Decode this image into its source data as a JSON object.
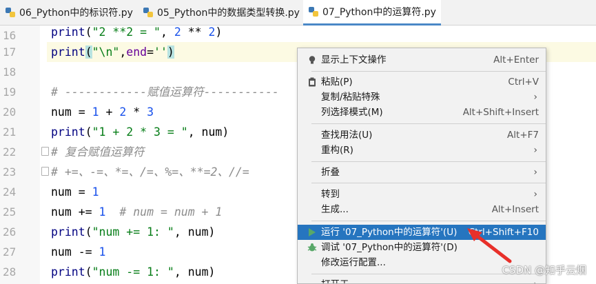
{
  "tabs": [
    {
      "label": "06_Python中的标识符.py"
    },
    {
      "label": "05_Python中的数据类型转换.py"
    },
    {
      "label": "07_Python中的运算符.py"
    }
  ],
  "line_numbers": [
    "16",
    "17",
    "18",
    "19",
    "20",
    "21",
    "22",
    "23",
    "24",
    "25",
    "26",
    "27",
    "28"
  ],
  "code": {
    "l16": {
      "fn": "print",
      "a": "(",
      "s": "\"2 **2 = \"",
      "b": ", ",
      "n1": "2",
      "c": " ** ",
      "n2": "2",
      "d": ")"
    },
    "l17": {
      "fn": "print",
      "a": "(",
      "s": "\"\\n\"",
      "b": ",",
      "k": "end",
      "e": "=",
      "s2": "''",
      "d": ")"
    },
    "l19": {
      "cmt": "# ------------赋值运算符-----------"
    },
    "l20": {
      "a": "num = ",
      "n1": "1",
      "b": " + ",
      "n2": "2",
      "c": " * ",
      "n3": "3"
    },
    "l21": {
      "fn": "print",
      "a": "(",
      "s": "\"1 + 2 * 3 = \"",
      "b": ", num)"
    },
    "l22": {
      "cmt": "# 复合赋值运算符"
    },
    "l23": {
      "cmt": "# +=、-=、*=、/=、%=、**=2、//="
    },
    "l24": {
      "a": "num = ",
      "n1": "1"
    },
    "l25": {
      "a": "num += ",
      "n1": "1",
      "cmt": "  # num = num + 1"
    },
    "l26": {
      "fn": "print",
      "a": "(",
      "s": "\"num += 1: \"",
      "b": ", num)"
    },
    "l27": {
      "a": "num -= ",
      "n1": "1"
    },
    "l28": {
      "fn": "print",
      "a": "(",
      "s": "\"num -= 1: \"",
      "b": ", num)"
    }
  },
  "menu": {
    "items": [
      {
        "label": "显示上下文操作",
        "shortcut": "Alt+Enter",
        "icon": "lightbulb-icon"
      },
      {
        "label": "粘贴(P)",
        "shortcut": "Ctrl+V",
        "icon": "clipboard-icon"
      },
      {
        "label": "复制/粘贴特殊",
        "submenu": true
      },
      {
        "label": "列选择模式(M)",
        "shortcut": "Alt+Shift+Insert"
      },
      {
        "label": "查找用法(U)",
        "shortcut": "Alt+F7"
      },
      {
        "label": "重构(R)",
        "submenu": true
      },
      {
        "label": "折叠",
        "submenu": true
      },
      {
        "label": "转到",
        "submenu": true
      },
      {
        "label": "生成...",
        "shortcut": "Alt+Insert"
      },
      {
        "label": "运行 '07_Python中的运算符'(U)",
        "shortcut": "Ctrl+Shift+F10",
        "icon": "run-icon"
      },
      {
        "label": "调试 '07_Python中的运算符'(D)",
        "icon": "debug-icon"
      },
      {
        "label": "修改运行配置..."
      },
      {
        "label": "打开于",
        "submenu": true
      }
    ],
    "submenu_arrow": "›"
  },
  "watermark": "CSDN @知乎云烟",
  "colors": {
    "accent": "#2675bf",
    "annotation_arrow": "#e8302a"
  }
}
